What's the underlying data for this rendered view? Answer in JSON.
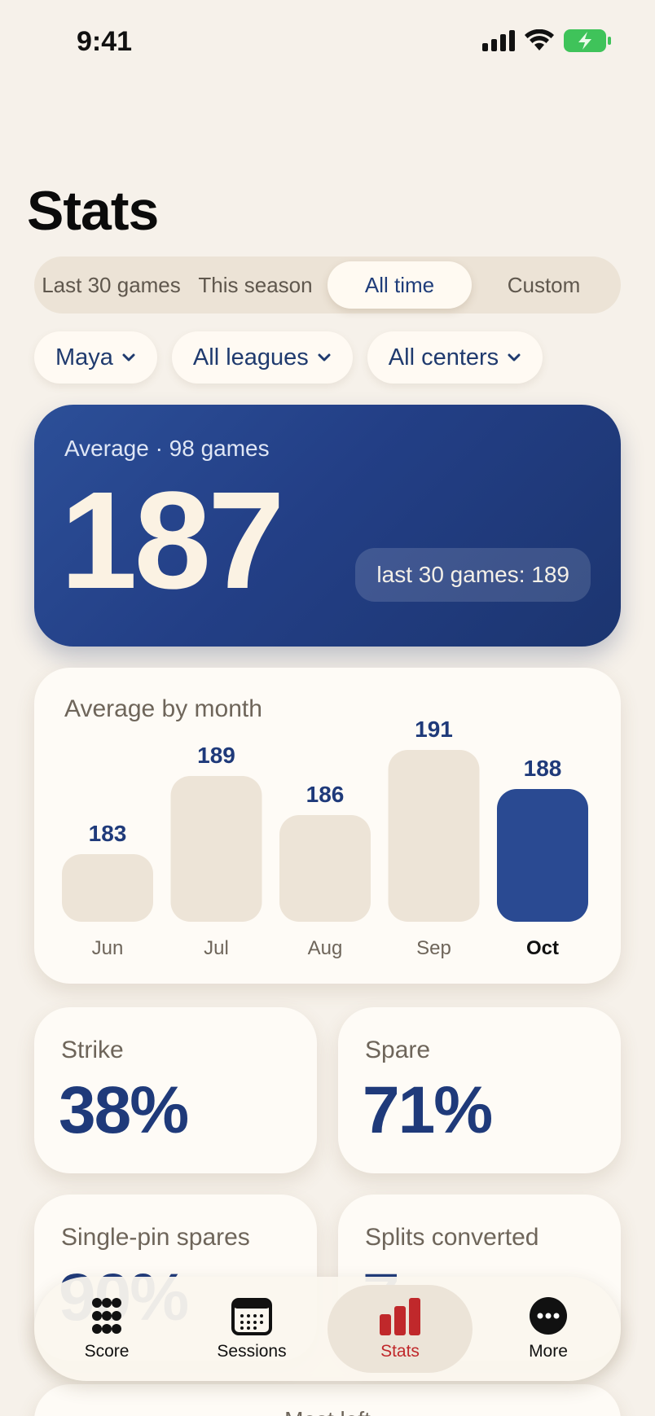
{
  "status_bar": {
    "time": "9:41",
    "battery_color": "#3fc35a"
  },
  "page": {
    "title": "Stats"
  },
  "range_tabs": [
    {
      "label": "Last 30 games",
      "active": false
    },
    {
      "label": "This season",
      "active": false
    },
    {
      "label": "All time",
      "active": true
    },
    {
      "label": "Custom",
      "active": false
    }
  ],
  "filters": [
    {
      "label": "Maya"
    },
    {
      "label": "All leagues"
    },
    {
      "label": "All centers"
    }
  ],
  "hero": {
    "label": "Average · 98 games",
    "value": "187",
    "badge": "last 30 games: 189"
  },
  "monthly": {
    "title": "Average by month"
  },
  "chart_data": {
    "type": "bar",
    "title": "Average by month",
    "categories": [
      "Jun",
      "Jul",
      "Aug",
      "Sep",
      "Oct"
    ],
    "values": [
      183,
      189,
      186,
      191,
      188
    ],
    "highlight_index": 4,
    "highlight_color": "#2a4a92",
    "bar_color": "#ede4d7"
  },
  "stats": [
    {
      "label": "Strike",
      "value": "38%"
    },
    {
      "label": "Spare",
      "value": "71%"
    },
    {
      "label": "Single-pin spares",
      "value": "90%"
    },
    {
      "label": "Splits converted",
      "value": "7"
    }
  ],
  "next_card": {
    "label": "Most left"
  },
  "tabbar": [
    {
      "label": "Score",
      "icon": "keypad-icon",
      "active": false
    },
    {
      "label": "Sessions",
      "icon": "calendar-icon",
      "active": false
    },
    {
      "label": "Stats",
      "icon": "bar-chart-icon",
      "active": true
    },
    {
      "label": "More",
      "icon": "more-icon",
      "active": false
    }
  ],
  "colors": {
    "accent": "#1f3a7a",
    "active_tab": "#c0282b",
    "background": "#f6f1ea"
  }
}
